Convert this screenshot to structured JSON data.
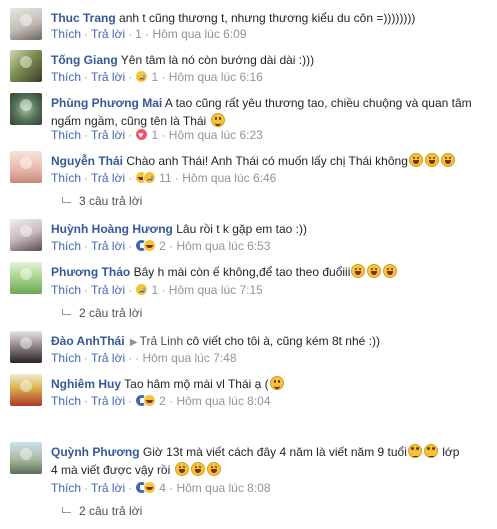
{
  "comments": [
    {
      "author": "Thuc Trang",
      "reply_to": "",
      "text": "anh t cũng thương t, nhưng thương kiểu du côn =))))))))",
      "emoji": [],
      "text2": "",
      "emoji2": [],
      "like": "Thích",
      "reply": "Trả lời",
      "reactions": [],
      "reaction_count": "",
      "time": "1 · Hôm qua lúc 6:09",
      "replies_label": ""
    },
    {
      "author": "Tống Giang",
      "reply_to": "",
      "text": "Yên tâm là nó còn bướng dài dài :)))",
      "emoji": [],
      "text2": "",
      "emoji2": [],
      "like": "Thích",
      "reply": "Trả lời",
      "reactions": [
        "sad"
      ],
      "reaction_count": "",
      "time": "1 · Hôm qua lúc 6:16",
      "replies_label": ""
    },
    {
      "author": "Phùng Phương Mai",
      "reply_to": "",
      "text": "A tao cũng rất yêu thương tao, chiều chuộng và quan tâm",
      "emoji": [],
      "text2": "ngấm ngầm, cũng tên là Thái",
      "emoji2": [
        "smile"
      ],
      "like": "Thích",
      "reply": "Trả lời",
      "reactions": [
        "love"
      ],
      "reaction_count": "",
      "time": "1 · Hôm qua lúc 6:23",
      "replies_label": ""
    },
    {
      "author": "Nguyễn Thái",
      "reply_to": "",
      "text": "Chào anh Thái! Anh Thái có muốn lấy chị Thái không",
      "emoji": [
        "laugh",
        "laugh",
        "laugh"
      ],
      "text2": "",
      "emoji2": [],
      "like": "Thích",
      "reply": "Trả lời",
      "reactions": [
        "haha",
        "sad"
      ],
      "reaction_count": "11",
      "time": "· Hôm qua lúc 6:46",
      "replies_label": "3 câu trả lời"
    },
    {
      "author": "Huỳnh Hoàng Hương",
      "reply_to": "",
      "text": "Lâu rồi t k gặp em tao :))",
      "emoji": [],
      "text2": "",
      "emoji2": [],
      "like": "Thích",
      "reply": "Trả lời",
      "reactions": [
        "like",
        "haha"
      ],
      "reaction_count": "2",
      "time": "· Hôm qua lúc 6:53",
      "replies_label": ""
    },
    {
      "author": "Phương Thảo",
      "reply_to": "",
      "text": "Bây h mài còn ế không,để tao theo đuổiii",
      "emoji": [
        "laugh",
        "laugh",
        "laugh"
      ],
      "text2": "",
      "emoji2": [],
      "like": "Thích",
      "reply": "Trả lời",
      "reactions": [
        "sad"
      ],
      "reaction_count": "",
      "time": "1 · Hôm qua lúc 7:15",
      "replies_label": "2 câu trả lời"
    },
    {
      "author": "Đào AnhThái",
      "reply_to": "Trả Linh",
      "text": "cô viết cho tôi à, cũng kém 8t nhé :))",
      "emoji": [],
      "text2": "",
      "emoji2": [],
      "like": "Thích",
      "reply": "Trả lời",
      "reactions": [],
      "reaction_count": "",
      "time": "· Hôm qua lúc 7:48",
      "replies_label": ""
    },
    {
      "author": "Nghiêm Huy",
      "reply_to": "",
      "text": "Tao hâm mộ mài vl Thái ạ (",
      "emoji": [
        "smile"
      ],
      "text2": "",
      "emoji2": [],
      "like": "Thích",
      "reply": "Trả lời",
      "reactions": [
        "like",
        "haha"
      ],
      "reaction_count": "2",
      "time": "· Hôm qua lúc 8:04",
      "replies_label": ""
    },
    {
      "author": "Quỳnh Phương",
      "reply_to": "",
      "text": "Giờ 13t mà viết cách đây 4 năm là viết năm 9 tuổi",
      "emoji": [
        "roll",
        "roll"
      ],
      "text3": "lớp",
      "text2": "4 mà viết được vậy rồi",
      "emoji2": [
        "laugh",
        "laugh",
        "laugh"
      ],
      "like": "Thích",
      "reply": "Trả lời",
      "reactions": [
        "like",
        "haha"
      ],
      "reaction_count": "4",
      "time": "· Hôm qua lúc 8:08",
      "replies_label": "2 câu trả lời"
    }
  ]
}
